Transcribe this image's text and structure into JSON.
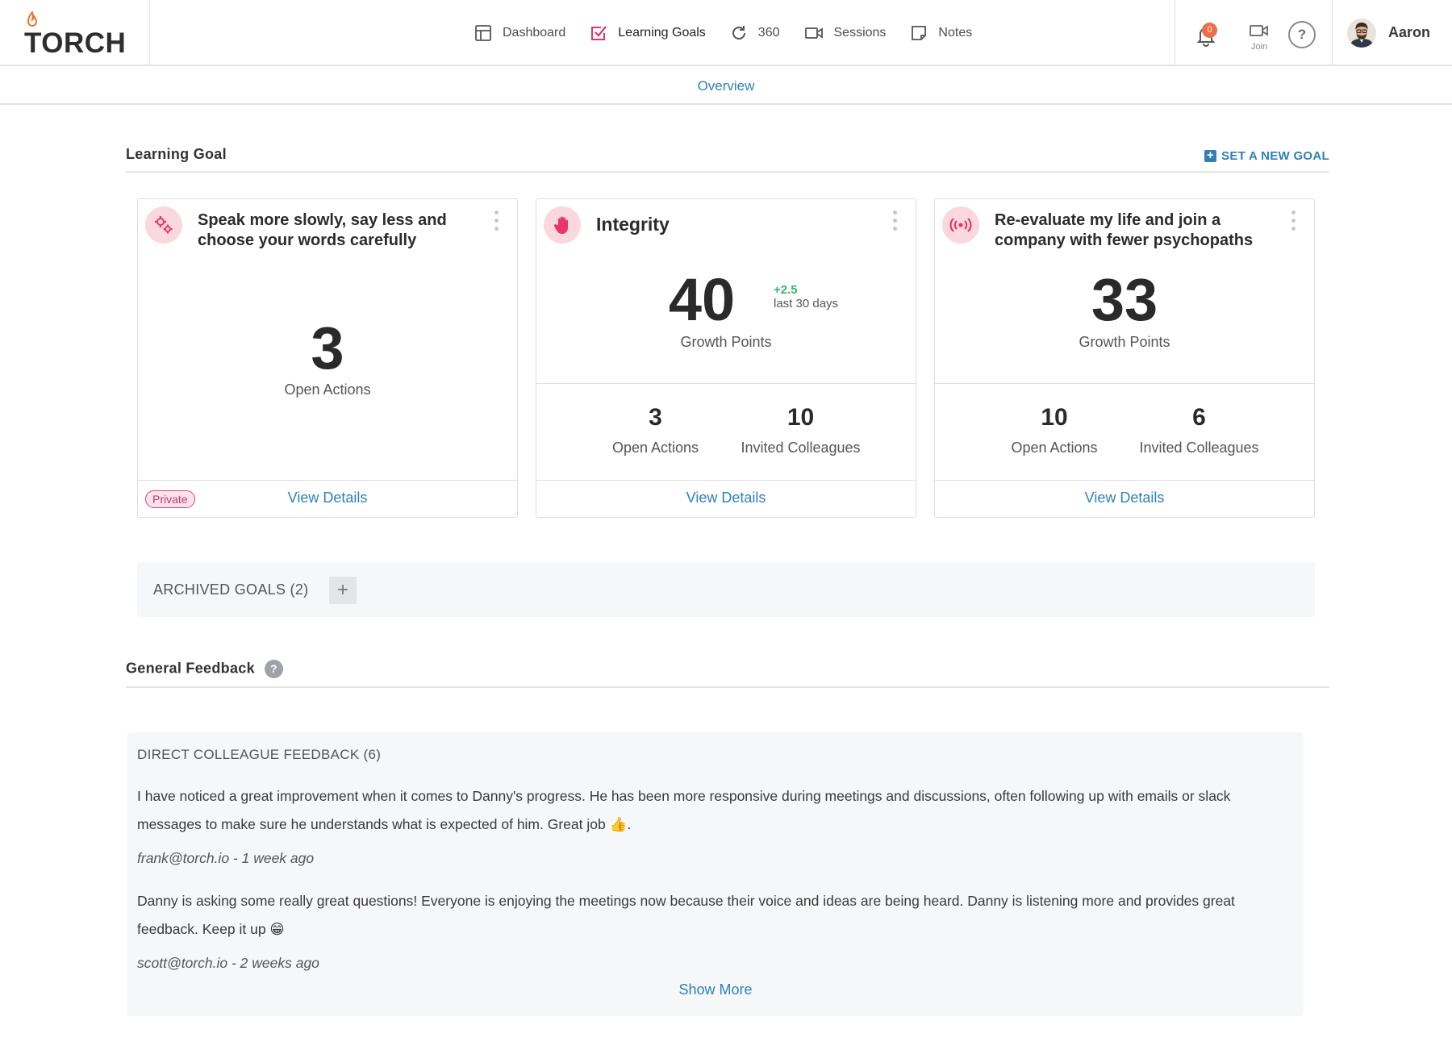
{
  "brand": {
    "name": "TORCH"
  },
  "nav": {
    "items": [
      {
        "label": "Dashboard",
        "icon": "dashboard-icon",
        "active": false
      },
      {
        "label": "Learning Goals",
        "icon": "checkbox-icon",
        "active": true
      },
      {
        "label": "360",
        "icon": "refresh-icon",
        "active": false
      },
      {
        "label": "Sessions",
        "icon": "video-icon",
        "active": false
      },
      {
        "label": "Notes",
        "icon": "note-icon",
        "active": false
      }
    ]
  },
  "header_right": {
    "notifications_count": "0",
    "join_label": "Join",
    "help_label": "?",
    "user_name": "Aaron"
  },
  "subnav": {
    "tab": "Overview"
  },
  "learning_goal": {
    "title": "Learning Goal",
    "set_goal_label": "SET A NEW GOAL",
    "cards": [
      {
        "title": "Speak more slowly, say less and choose your words carefully",
        "icon": "gears-icon",
        "metric_value": "3",
        "metric_label": "Open Actions",
        "private_label": "Private",
        "view_details": "View Details"
      },
      {
        "title": "Integrity",
        "icon": "hand-icon",
        "metric_value": "40",
        "metric_label": "Growth Points",
        "delta": "+2.5",
        "delta_period": "last 30 days",
        "stats": [
          {
            "value": "3",
            "label": "Open Actions"
          },
          {
            "value": "10",
            "label": "Invited Colleagues"
          }
        ],
        "view_details": "View Details"
      },
      {
        "title": "Re-evaluate my life and join a company with fewer psychopaths",
        "icon": "broadcast-icon",
        "metric_value": "33",
        "metric_label": "Growth Points",
        "stats": [
          {
            "value": "10",
            "label": "Open Actions"
          },
          {
            "value": "6",
            "label": "Invited Colleagues"
          }
        ],
        "view_details": "View Details"
      }
    ],
    "archived_label": "ARCHIVED GOALS (2)",
    "archived_plus": "+"
  },
  "general_feedback": {
    "title": "General Feedback",
    "help_label": "?",
    "box_title": "DIRECT COLLEAGUE FEEDBACK (6)",
    "entries": [
      {
        "text": "I have noticed a great improvement when it comes to Danny's progress. He has been more responsive during meetings and discussions, often following up with emails or slack messages to make sure he understands what is expected of him. Great job 👍.",
        "author": "frank@torch.io - 1 week ago"
      },
      {
        "text": "Danny is asking some really great questions! Everyone is enjoying the meetings now because their voice and ideas are being heard. Danny is listening more and provides great feedback. Keep it up 😁",
        "author": "scott@torch.io - 2 weeks ago"
      }
    ],
    "show_more": "Show More"
  },
  "colors": {
    "accent_blue": "#2f80b7",
    "brand_orange": "#f0732f",
    "goal_pink": "#e8356c",
    "positive_green": "#3bb46a"
  }
}
